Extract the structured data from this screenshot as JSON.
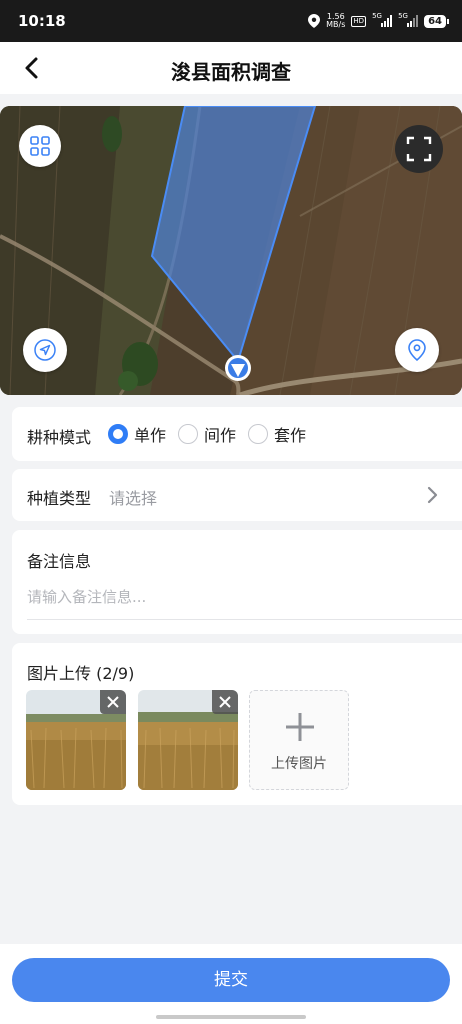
{
  "status_bar": {
    "time": "10:18",
    "net_speed_value": "1.56",
    "net_speed_unit": "MB/s",
    "hd_badge": "HD",
    "sim1": "5G",
    "sim2": "5G",
    "battery": "64"
  },
  "header": {
    "title": "浚县面积调查",
    "back_icon": "chevron-left-icon"
  },
  "map": {
    "layers_icon": "grid-icon",
    "fullscreen_icon": "fullscreen-icon",
    "locate_icon": "navigation-arrow-icon",
    "marker_icon": "map-pin-icon",
    "polygon_color": "#3b82f6"
  },
  "form": {
    "mode": {
      "label": "耕种模式",
      "options": [
        "单作",
        "间作",
        "套作"
      ],
      "selected": "单作"
    },
    "crop_type": {
      "label": "种植类型",
      "placeholder": "请选择"
    },
    "remarks": {
      "label": "备注信息",
      "placeholder": "请输入备注信息..."
    },
    "images": {
      "label": "图片上传 (2/9)",
      "upload_label": "上传图片"
    }
  },
  "submit_label": "提交",
  "colors": {
    "accent": "#2f7df6",
    "submit": "#4a87ee",
    "background": "#f2f3f5"
  }
}
